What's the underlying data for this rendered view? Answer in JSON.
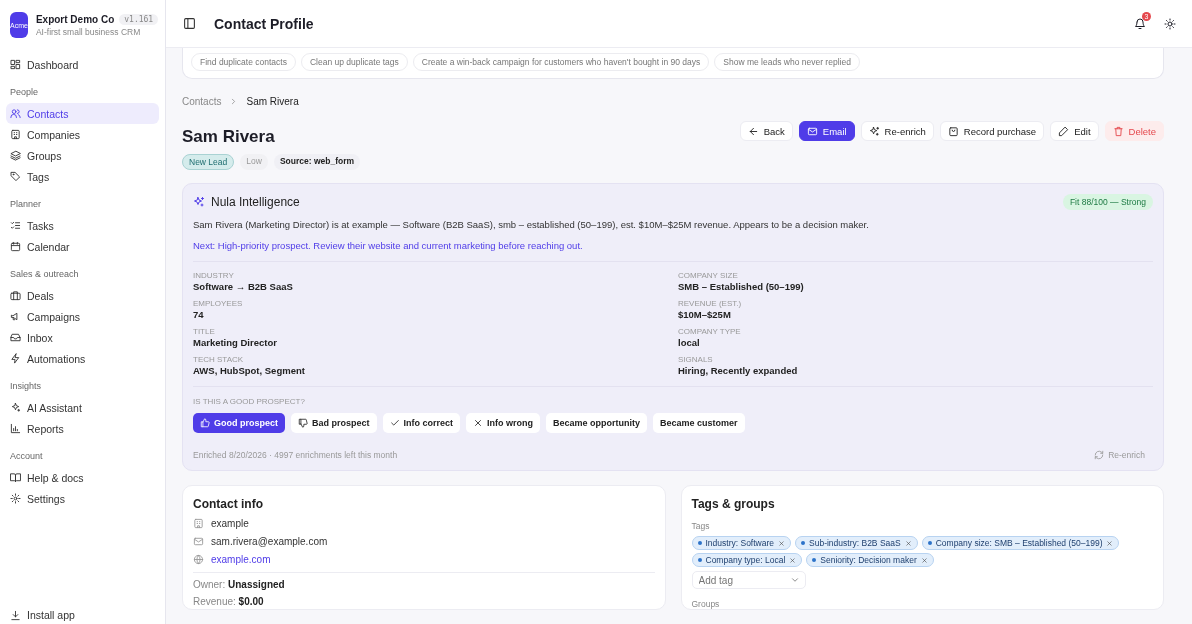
{
  "sidebar": {
    "org_logo": "Acme",
    "org_name": "Export Demo Co",
    "version": "v1.161",
    "tagline": "AI-first small business CRM",
    "sections": [
      {
        "items": [
          {
            "label": "Dashboard",
            "selected": false
          }
        ]
      },
      {
        "title": "People",
        "items": [
          {
            "label": "Contacts",
            "selected": true
          },
          {
            "label": "Companies",
            "selected": false
          },
          {
            "label": "Groups",
            "selected": false
          },
          {
            "label": "Tags",
            "selected": false
          }
        ]
      },
      {
        "title": "Planner",
        "items": [
          {
            "label": "Tasks",
            "selected": false
          },
          {
            "label": "Calendar",
            "selected": false
          }
        ]
      },
      {
        "title": "Sales & outreach",
        "items": [
          {
            "label": "Deals",
            "selected": false
          },
          {
            "label": "Campaigns",
            "selected": false
          },
          {
            "label": "Inbox",
            "selected": false
          },
          {
            "label": "Automations",
            "selected": false
          }
        ]
      },
      {
        "title": "Insights",
        "items": [
          {
            "label": "AI Assistant",
            "selected": false
          },
          {
            "label": "Reports",
            "selected": false
          }
        ]
      },
      {
        "title": "Account",
        "items": [
          {
            "label": "Help & docs",
            "selected": false
          },
          {
            "label": "Settings",
            "selected": false
          }
        ]
      }
    ],
    "footer": "Install app"
  },
  "header": {
    "title": "Contact Profile",
    "notification_count": "3"
  },
  "suggestions": [
    "Find duplicate contacts",
    "Clean up duplicate tags",
    "Create a win-back campaign for customers who haven't bought in 90 days",
    "Show me leads who never replied"
  ],
  "breadcrumb": [
    "Contacts",
    "Sam Rivera"
  ],
  "contact": {
    "name": "Sam Rivera",
    "badges": [
      {
        "kind": "status",
        "label": "New Lead"
      },
      {
        "kind": "plain",
        "label": "Low"
      },
      {
        "kind": "source",
        "label": "Source: web_form"
      }
    ]
  },
  "actions": [
    {
      "kind": "back",
      "label": "Back"
    },
    {
      "kind": "primary",
      "label": "Email"
    },
    {
      "kind": "enrich",
      "label": "Re-enrich"
    },
    {
      "kind": "purchase",
      "label": "Record purchase"
    },
    {
      "kind": "edit",
      "label": "Edit"
    },
    {
      "kind": "danger",
      "label": "Delete"
    }
  ],
  "intelligence": {
    "title": "Nula Intelligence",
    "fit": "Fit 88/100 — Strong",
    "summary": "Sam Rivera (Marketing Director) is at example — Software (B2B SaaS), smb – established (50–199), est. $10M–$25M revenue. Appears to be a decision maker.",
    "next": "Next: High-priority prospect. Review their website and current marketing before reaching out.",
    "fields": [
      {
        "label": "INDUSTRY",
        "value": "Software → B2B SaaS"
      },
      {
        "label": "COMPANY SIZE",
        "value": "SMB – Established (50–199)"
      },
      {
        "label": "EMPLOYEES",
        "value": "74"
      },
      {
        "label": "REVENUE (EST.)",
        "value": "$10M–$25M"
      },
      {
        "label": "TITLE",
        "value": "Marketing Director"
      },
      {
        "label": "COMPANY TYPE",
        "value": "local"
      },
      {
        "label": "TECH STACK",
        "value": "AWS, HubSpot, Segment"
      },
      {
        "label": "SIGNALS",
        "value": "Hiring, Recently expanded"
      }
    ],
    "question": "IS THIS A GOOD PROSPECT?",
    "feedback": [
      {
        "kind": "up",
        "label": "Good prospect",
        "selected": true
      },
      {
        "kind": "down",
        "label": "Bad prospect",
        "selected": false
      },
      {
        "kind": "check",
        "label": "Info correct",
        "selected": false
      },
      {
        "kind": "cross",
        "label": "Info wrong",
        "selected": false
      },
      {
        "kind": "none",
        "label": "Became opportunity",
        "selected": false
      },
      {
        "kind": "none",
        "label": "Became customer",
        "selected": false
      }
    ],
    "enriched": "Enriched 8/20/2026 · 4997 enrichments left this month",
    "reenrich": "Re-enrich"
  },
  "contact_info": {
    "title": "Contact info",
    "lines": [
      {
        "kind": "company",
        "text": "example"
      },
      {
        "kind": "email",
        "text": "sam.rivera@example.com"
      },
      {
        "kind": "website",
        "text": "example.com"
      }
    ],
    "details": [
      {
        "label": "Owner:",
        "value": "Unassigned"
      },
      {
        "label": "Revenue:",
        "value": "$0.00"
      }
    ]
  },
  "tags_groups": {
    "title": "Tags & groups",
    "tags_label": "Tags",
    "tags": [
      "Industry: Software",
      "Sub-industry: B2B SaaS",
      "Company size: SMB – Established (50–199)",
      "Company type: Local",
      "Seniority: Decision maker"
    ],
    "add_placeholder": "Add tag",
    "groups_label": "Groups"
  }
}
